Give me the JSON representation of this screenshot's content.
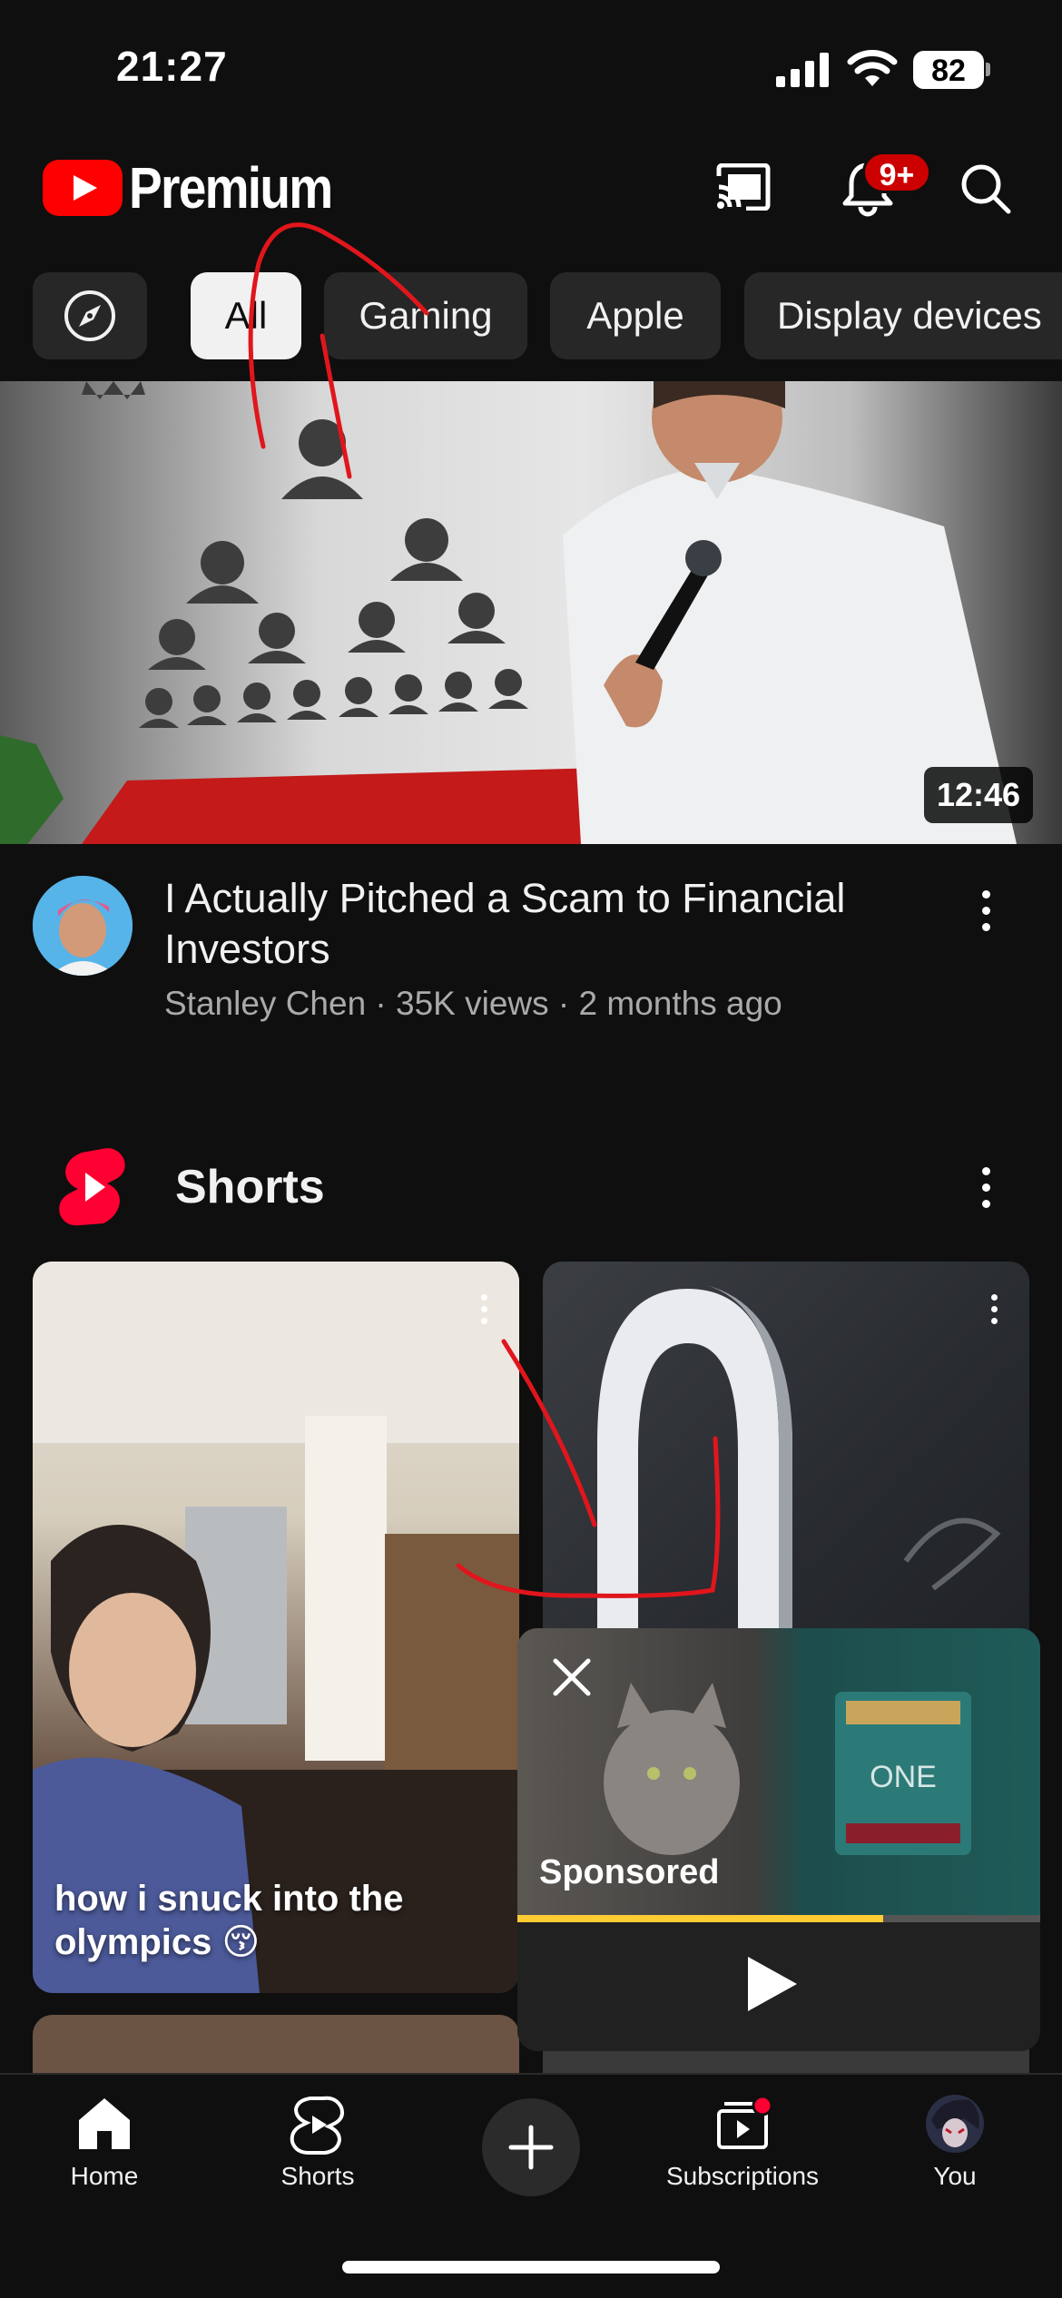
{
  "status_bar": {
    "time": "21:27",
    "battery": "82"
  },
  "header": {
    "brand": "Premium",
    "notification_count": "9+"
  },
  "chips": [
    {
      "label": "All",
      "selected": true
    },
    {
      "label": "Gaming"
    },
    {
      "label": "Apple"
    },
    {
      "label": "Display devices"
    }
  ],
  "video": {
    "duration": "12:46",
    "title": "I Actually Pitched a Scam to Financial Investors",
    "meta": "Stanley Chen · 35K views · 2 months ago"
  },
  "shorts": {
    "title": "Shorts",
    "items": [
      {
        "caption": "how i snuck into the olympics 😚"
      }
    ]
  },
  "ad": {
    "label": "Sponsored",
    "progress": 0.7
  },
  "nav": {
    "home": "Home",
    "shorts": "Shorts",
    "subscriptions": "Subscriptions",
    "you": "You"
  },
  "colors": {
    "accent": "#ff0000",
    "background": "#0f0f0f",
    "chip": "#272727",
    "ad_progress": "#ffcc33"
  }
}
